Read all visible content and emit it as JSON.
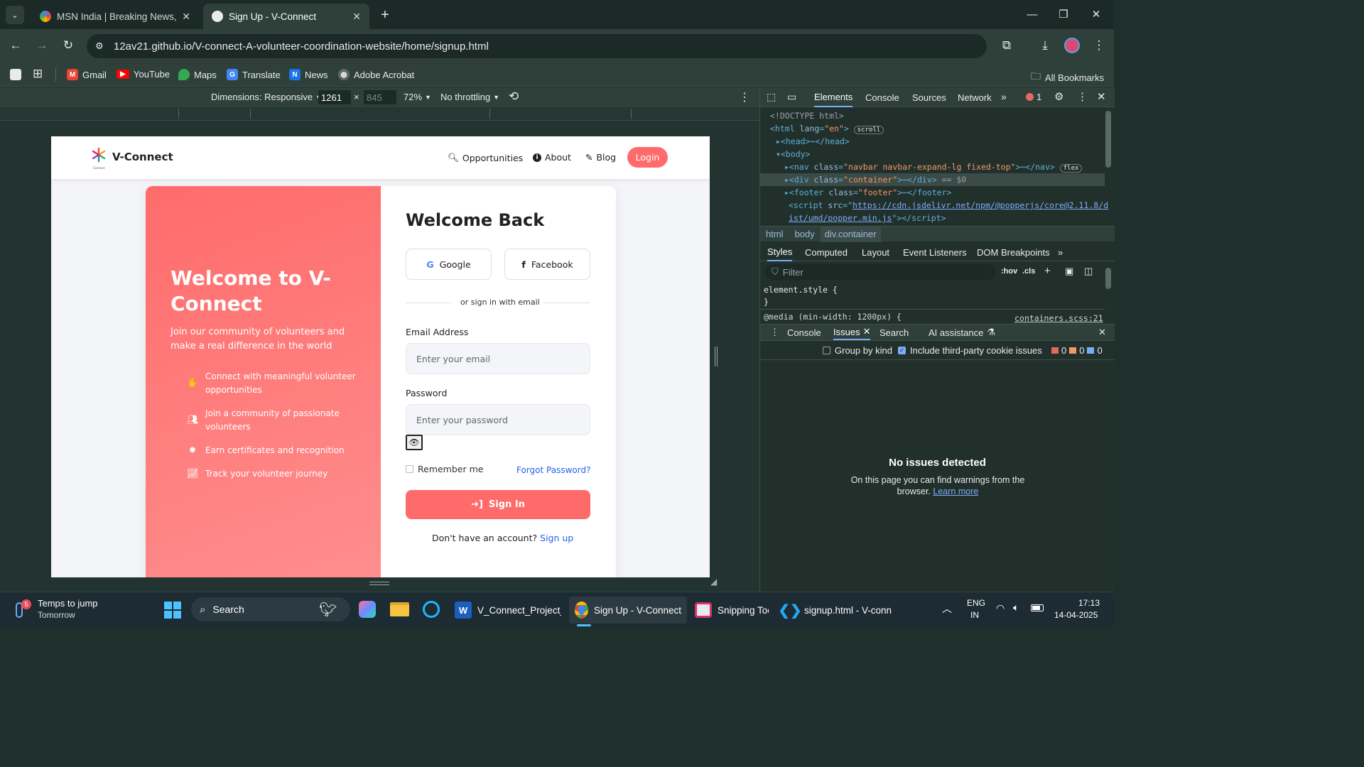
{
  "browser": {
    "tabs": [
      {
        "title": "MSN India | Breaking News, Ent"
      },
      {
        "title": "Sign Up - V-Connect"
      }
    ],
    "url": "12av21.github.io/V-connect-A-volunteer-coordination-website/home/signup.html",
    "bookmarks": [
      "Gmail",
      "YouTube",
      "Maps",
      "Translate",
      "News",
      "Adobe Acrobat"
    ],
    "all_bookmarks": "All Bookmarks"
  },
  "device_toolbar": {
    "dimensions": "Dimensions: Responsive",
    "width": "1261",
    "height_placeholder": "845",
    "zoom": "72%",
    "throttling": "No throttling"
  },
  "site": {
    "brand": "V-Connect",
    "logo_caption": "Connect",
    "nav": {
      "opportunities": "Opportunities",
      "about": "About",
      "blog": "Blog",
      "login": "Login"
    },
    "left": {
      "heading": "Welcome to V-Connect",
      "sub": "Join our community of volunteers and make a real difference in the world",
      "features": [
        "Connect with meaningful volunteer opportunities",
        "Join a community of passionate volunteers",
        "Earn certificates and recognition",
        "Track your volunteer journey"
      ]
    },
    "form": {
      "title": "Welcome Back",
      "google": "Google",
      "facebook": "Facebook",
      "divider": "or sign in with email",
      "email_label": "Email Address",
      "email_placeholder": "Enter your email",
      "password_label": "Password",
      "password_placeholder": "Enter your password",
      "remember": "Remember me",
      "forgot": "Forgot Password?",
      "signin": "Sign In",
      "no_account": "Don't have an account?",
      "signup": "Sign up"
    }
  },
  "devtools": {
    "tabs": [
      "Elements",
      "Console",
      "Sources",
      "Network"
    ],
    "error_count": "1",
    "breadcrumbs": [
      "html",
      "body",
      "div.container"
    ],
    "style_tabs": [
      "Styles",
      "Computed",
      "Layout",
      "Event Listeners",
      "DOM Breakpoints"
    ],
    "filter_placeholder": "Filter",
    "hov": ":hov",
    "cls": ".cls",
    "element_style": "element.style {",
    "close_brace": "}",
    "media_rule": "@media (min-width: 1200px) {",
    "media_source": "containers.scss:21",
    "drawer_tabs": [
      "Console",
      "Issues",
      "Search",
      "AI assistance"
    ],
    "group_by_kind": "Group by kind",
    "third_party": "Include third-party cookie issues",
    "counts": [
      "0",
      "0",
      "0"
    ],
    "no_issues_title": "No issues detected",
    "no_issues_text": "On this page you can find warnings from the browser.",
    "learn_more": "Learn more",
    "dom": {
      "doctype": "<!DOCTYPE html>",
      "scroll": "scroll",
      "flex": "flex",
      "sel": "== $0",
      "script_src": "https://cdn.jsdelivr.net/npm/@popperjs/core@2.11.8/d",
      "script_src2": "ist/umd/popper.min.js"
    }
  },
  "taskbar": {
    "weather_title": "Temps to jump",
    "weather_sub": "Tomorrow",
    "weather_badge": "5",
    "search": "Search",
    "apps": [
      "V_Connect_Project_R",
      "Sign Up - V-Connect",
      "Snipping Toc",
      "signup.html - V-conn"
    ],
    "lang1": "ENG",
    "lang2": "IN",
    "time": "17:13",
    "date": "14-04-2025"
  },
  "colors": {
    "accent": "#ff6b6b",
    "link": "#2563eb",
    "devtools_blue": "#7cacf8"
  }
}
